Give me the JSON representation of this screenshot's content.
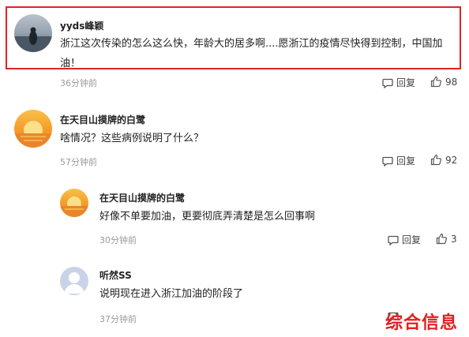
{
  "comments": [
    {
      "author": "yyds峰颖",
      "text": "浙江这次传染的怎么这么快，年龄大的居多啊....愿浙江的疫情尽快得到控制，中国加油！",
      "time": "36分钟前",
      "reply_label": "回复",
      "likes": "98"
    },
    {
      "author": "在天目山摸牌的白鹭",
      "text": "啥情况？这些病例说明了什么？",
      "time": "57分钟前",
      "reply_label": "回复",
      "likes": "92"
    },
    {
      "author": "在天目山摸牌的白鹭",
      "text": "好像不单要加油，更要彻底弄清楚是怎么回事啊",
      "time": "30分钟前",
      "reply_label": "回复",
      "likes": "3"
    },
    {
      "author": "听然SS",
      "text": "说明现在进入浙江加油的阶段了",
      "time": "37分钟前",
      "reply_label": "",
      "likes": ""
    }
  ],
  "watermark": "综合信息",
  "colors": {
    "highlight": "#e02424",
    "watermark": "#e02020",
    "meta": "#999999"
  },
  "icons": {
    "reply": "comment-bubble-icon",
    "like": "thumbs-up-icon"
  }
}
